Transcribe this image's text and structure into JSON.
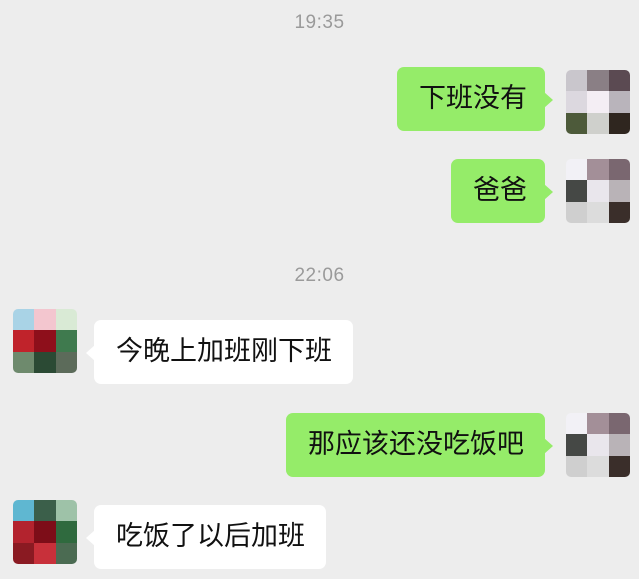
{
  "chat": {
    "timestamps": [
      "19:35",
      "22:06"
    ],
    "messages": [
      {
        "from": "self",
        "text": "下班没有"
      },
      {
        "from": "self",
        "text": "爸爸"
      },
      {
        "from": "other",
        "text": "今晚上加班刚下班"
      },
      {
        "from": "self",
        "text": "那应该还没吃饭吧"
      },
      {
        "from": "other",
        "text": "吃饭了以后加班"
      }
    ]
  },
  "colors": {
    "background": "#ededed",
    "sent_bubble": "#95ec69",
    "received_bubble": "#ffffff",
    "timestamp_text": "#9a9a9a"
  },
  "icons": {
    "self_avatar": "pixelated-avatar-icon",
    "other_avatar": "pixelated-avatar-icon"
  }
}
